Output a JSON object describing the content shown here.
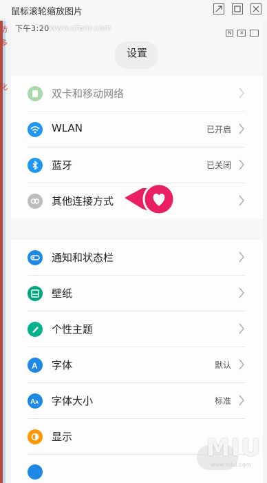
{
  "window": {
    "title": "鼠标滚轮缩放图片"
  },
  "status_bar": {
    "time": "下午3:20",
    "url_watermark": "www.cfanr.com",
    "icons": [
      "n-icon",
      "x-icon",
      "battery-icon"
    ]
  },
  "left_strip": {
    "fragments": [
      "访",
      "多",
      "化",
      "!"
    ]
  },
  "page": {
    "title": "设置"
  },
  "groups": [
    {
      "items": [
        {
          "label": "双卡和移动网络",
          "value": "",
          "icon": "sim-icon",
          "color": "#4caf50",
          "dimmed": true
        },
        {
          "label": "WLAN",
          "value": "已开启",
          "icon": "wifi-icon",
          "color": "#2196f3",
          "dimmed": false
        },
        {
          "label": "蓝牙",
          "value": "已关闭",
          "icon": "bluetooth-icon",
          "color": "#2196f3",
          "dimmed": false
        },
        {
          "label": "其他连接方式",
          "value": "",
          "icon": "link-icon",
          "color": "#9e9e9e",
          "dimmed": false
        }
      ]
    },
    {
      "items": [
        {
          "label": "通知和状态栏",
          "value": "",
          "icon": "notification-icon",
          "color": "#1e88e5"
        },
        {
          "label": "壁纸",
          "value": "",
          "icon": "wallpaper-icon",
          "color": "#00a57a"
        },
        {
          "label": "个性主题",
          "value": "",
          "icon": "theme-icon",
          "color": "#00b38a"
        },
        {
          "label": "字体",
          "value": "默认",
          "icon": "font-icon",
          "color": "#1e88e5"
        },
        {
          "label": "字体大小",
          "value": "标准",
          "icon": "font-size-icon",
          "color": "#1e88e5"
        },
        {
          "label": "显示",
          "value": "",
          "icon": "display-icon",
          "color": "#ff9800"
        }
      ]
    }
  ],
  "watermark": {
    "logo": "MIUI",
    "site": "www.miui.com"
  },
  "colors": {
    "pointer": "#e91e63"
  }
}
